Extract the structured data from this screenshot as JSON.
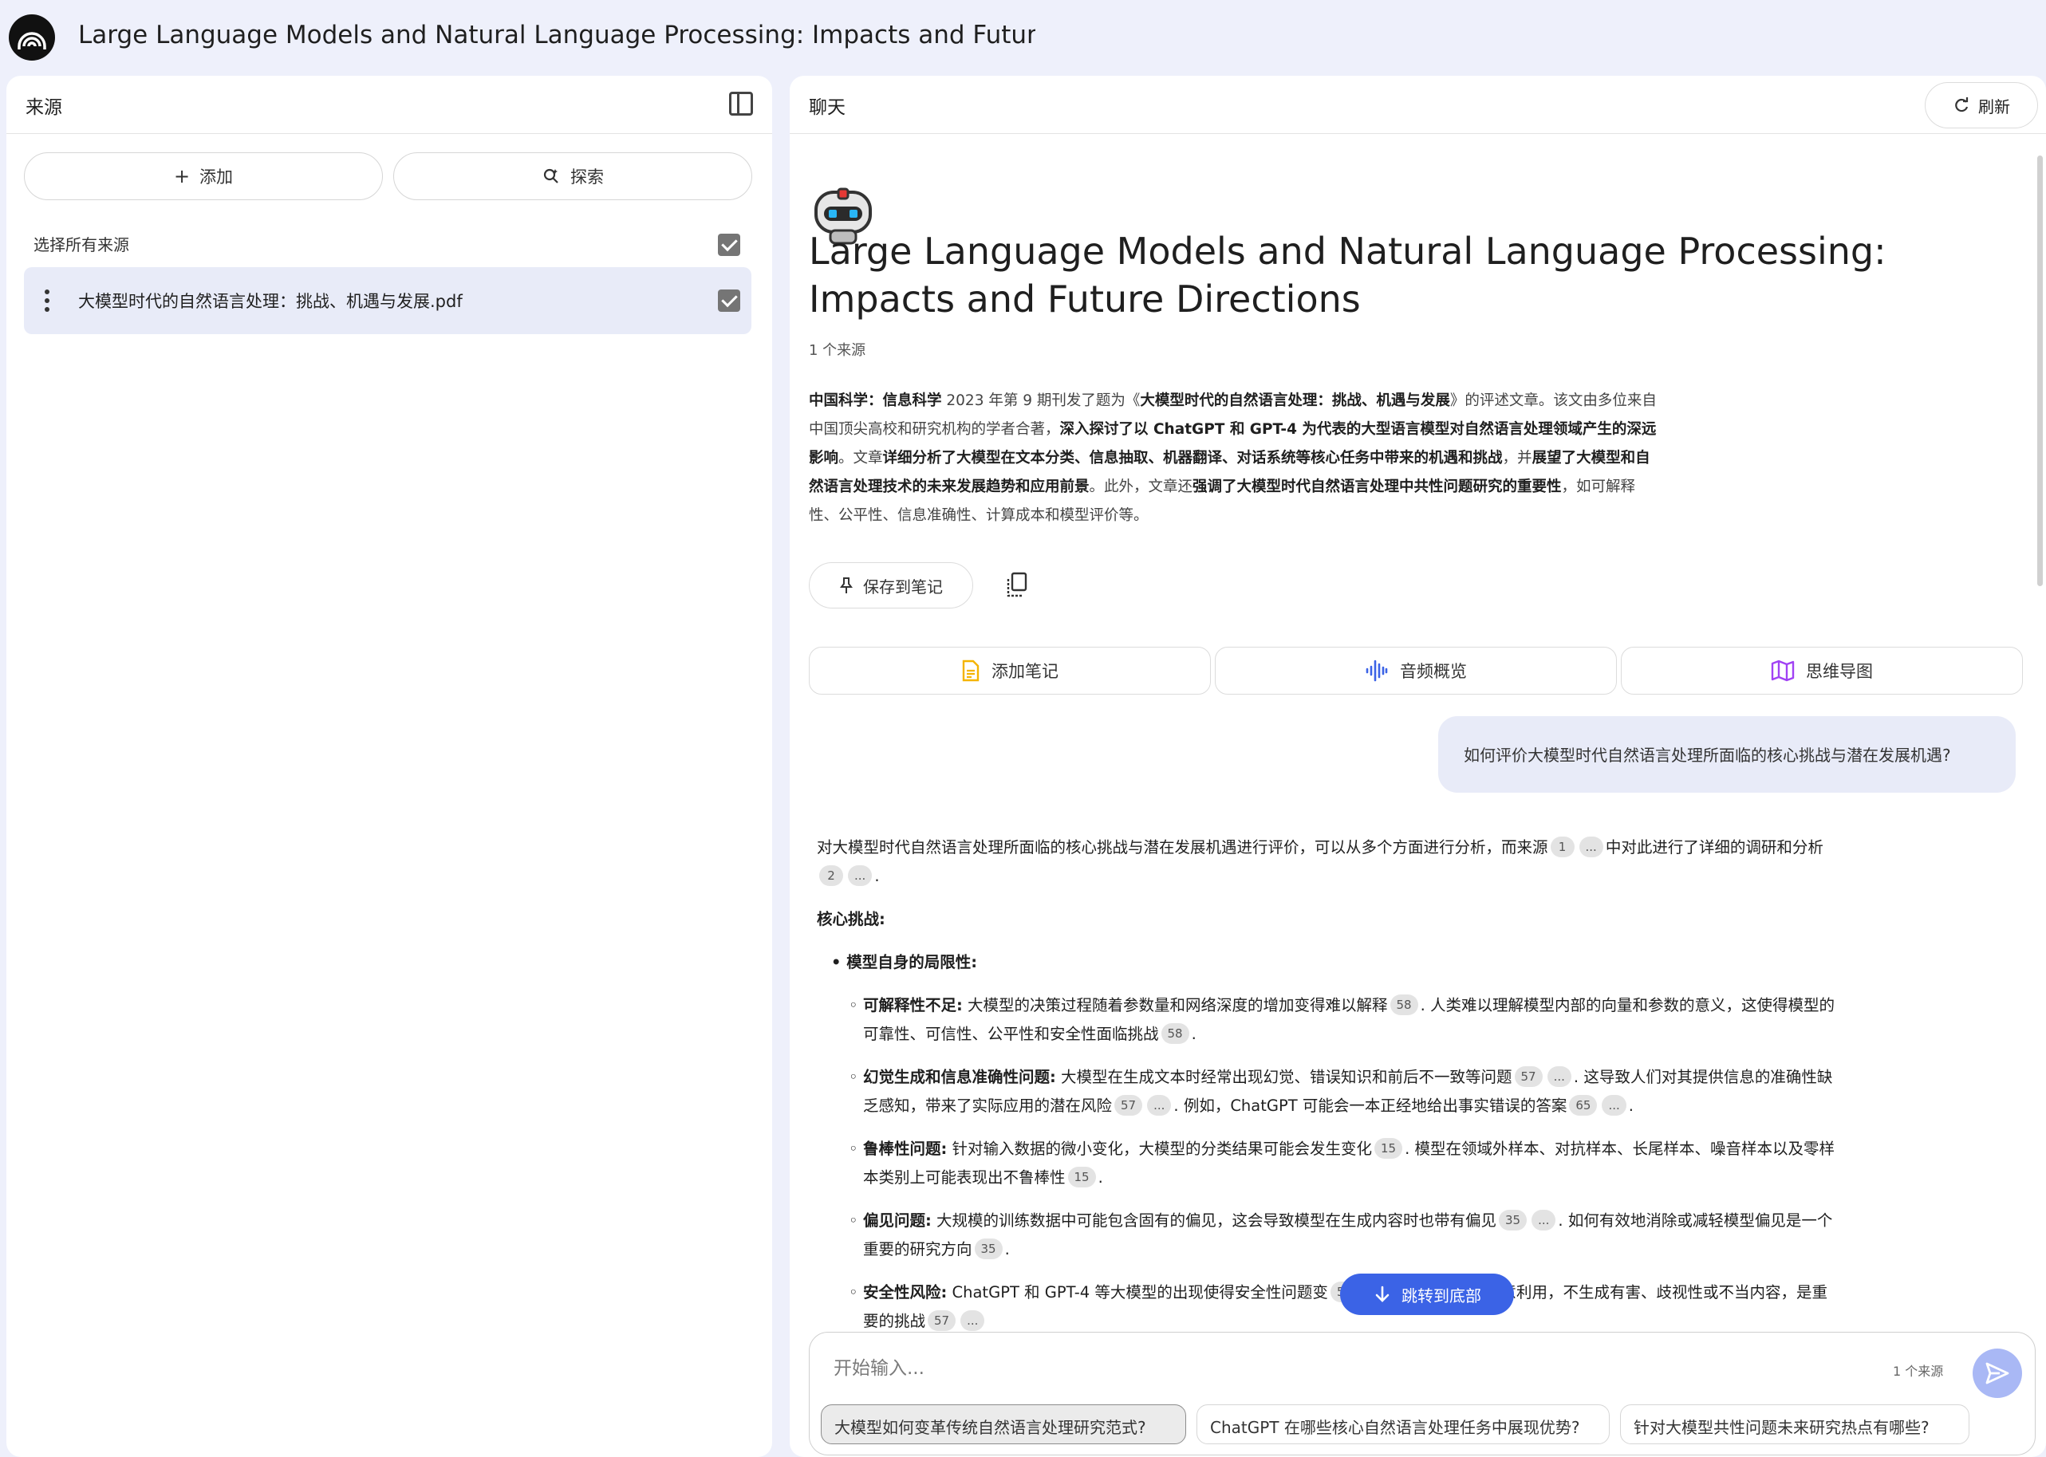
{
  "app": {
    "title": "Large Language Models and Natural Language Processing: Impacts and Future Directions",
    "logo_icon": "notebook-logo-icon"
  },
  "sources_panel": {
    "title": "来源",
    "add_label": "添加",
    "explore_label": "探索",
    "select_all_label": "选择所有来源",
    "select_all_checked": true,
    "items": [
      {
        "name": "大模型时代的自然语言处理：挑战、机遇与发展.pdf",
        "checked": true
      }
    ]
  },
  "chat_panel": {
    "title": "聊天",
    "refresh_label": "刷新",
    "doc_title": "Large Language Models and Natural Language Processing: Impacts and Future Directions",
    "source_count": "1 个来源",
    "summary": {
      "s1_bold": "中国科学：信息科学",
      "s2": " 2023 年第 9 期刊发了题为《",
      "s3_bold": "大模型时代的自然语言处理：挑战、机遇与发展",
      "s4": "》的评述文章。该文由多位来自中国顶尖高校和研究机构的学者合著，",
      "s5_bold": "深入探讨了以 ChatGPT 和 GPT-4 为代表的大型语言模型对自然语言处理领域产生的深远影响",
      "s6": "。文章",
      "s7_bold": "详细分析了大模型在文本分类、信息抽取、机器翻译、对话系统等核心任务中带来的机遇和挑战",
      "s8": "，并",
      "s9_bold": "展望了大模型和自然语言处理技术的未来发展趋势和应用前景",
      "s10": "。此外，文章还",
      "s11_bold": "强调了大模型时代自然语言处理中共性问题研究的重要性",
      "s12": "，如可解释性、公平性、信息准确性、计算成本和模型评价等。"
    },
    "save_note_label": "保存到笔记",
    "actions": {
      "add_note": "添加笔记",
      "audio_overview": "音频概览",
      "mind_map": "思维导图"
    },
    "user_question": "如何评价大模型时代自然语言处理所面临的核心挑战与潜在发展机遇?",
    "answer": {
      "intro_1": "对大模型时代自然语言处理所面临的核心挑战与潜在发展机遇进行评价，可以从多个方面进行分析，而来源",
      "intro_2": "中对此进行了详细的调研和分析",
      "intro_end": ".",
      "heading_challenges": "核心挑战:",
      "bullet_model_limits": "• 模型自身的局限性:",
      "interp_title": "可解释性不足:",
      "interp_1": " 大模型的决策过程随着参数量和网络深度的增加变得难以解释",
      "interp_2": ". 人类难以理解模型内部的向量和参数的意义，这使得模型的可靠性、可信性、公平性和安全性面临挑战",
      "halluc_title": "幻觉生成和信息准确性问题:",
      "halluc_1": " 大模型在生成文本时经常出现幻觉、错误知识和前后不一致等问题",
      "halluc_2": ". 这导致人们对其提供信息的准确性缺乏感知，带来了实际应用的潜在风险",
      "halluc_3": ". 例如，ChatGPT 可能会一本正经地给出事实错误的答案",
      "robust_title": "鲁棒性问题:",
      "robust_1": " 针对输入数据的微小变化，大模型的分类结果可能会发生变化",
      "robust_2": ". 模型在领域外样本、对抗样本、长尾样本、噪音样本以及零样本类别上可能表现出不鲁棒性",
      "bias_title": "偏见问题:",
      "bias_1": " 大规模的训练数据中可能包含固有的偏见，这会导致模型在生成内容时也带有偏见",
      "bias_2": ". 如何有效地消除或减轻模型偏见是一个重要的研究方向",
      "safety_title": "安全性风险:",
      "safety_1": " ChatGPT 和 GPT-4 等大模型的出现使得安全性问题变",
      "safety_2": "如何保障模型不被恶意利用，不生成有害、歧视性或不当内容，是重要的挑战",
      "ellipsis": "...",
      "c1": "1",
      "c2": "2",
      "c58": "58",
      "c57": "57",
      "c65": "65",
      "c15": "15",
      "c35": "35"
    },
    "jump_label": "跳转到底部",
    "input": {
      "placeholder": "开始输入...",
      "sources": "1 个来源"
    },
    "suggestions": [
      "大模型如何变革传统自然语言处理研究范式?",
      "ChatGPT 在哪些核心自然语言处理任务中展现优势?",
      "针对大模型共性问题未来研究热点有哪些?"
    ]
  },
  "colors": {
    "background": "#eef0fb",
    "panel": "#ffffff",
    "selected": "#e8ebf8",
    "accent": "#3b63e6",
    "send": "#a9b8f5",
    "note_icon": "#f4b400",
    "audio_icon": "#3b63e6",
    "mind_icon": "#a142f4"
  }
}
